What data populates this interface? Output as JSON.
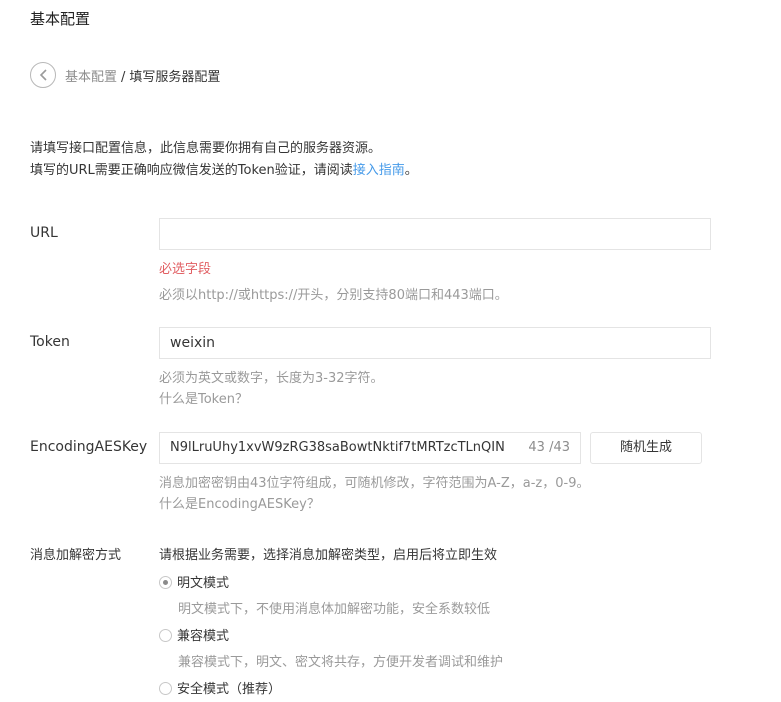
{
  "page_title": "基本配置",
  "breadcrumb": {
    "parent": "基本配置",
    "separator": "/",
    "current": "填写服务器配置"
  },
  "intro": {
    "line1": "请填写接口配置信息，此信息需要你拥有自己的服务器资源。",
    "line2_prefix": "填写的URL需要正确响应微信发送的Token验证，请阅读",
    "line2_link": "接入指南",
    "line2_suffix": "。"
  },
  "url": {
    "label": "URL",
    "value": "",
    "error": "必选字段",
    "hint": "必须以http://或https://开头，分别支持80端口和443端口。"
  },
  "token": {
    "label": "Token",
    "value": "weixin",
    "hint": "必须为英文或数字，长度为3-32字符。",
    "help_link": "什么是Token？"
  },
  "aes": {
    "label": "EncodingAESKey",
    "value": "N9lLruUhy1xvW9zRG38saBowtNktif7tMRTzcTLnQIN",
    "counter": "43 /43",
    "generate_button": "随机生成",
    "hint": "消息加密密钥由43位字符组成，可随机修改，字符范围为A-Z，a-z，0-9。",
    "help_link": "什么是EncodingAESKey？"
  },
  "encryption": {
    "label": "消息加解密方式",
    "description": "请根据业务需要，选择消息加解密类型，启用后将立即生效",
    "options": [
      {
        "label": "明文模式",
        "desc": "明文模式下，不使用消息体加解密功能，安全系数较低",
        "selected": true
      },
      {
        "label": "兼容模式",
        "desc": "兼容模式下，明文、密文将共存，方便开发者调试和维护",
        "selected": false
      },
      {
        "label": "安全模式（推荐）",
        "desc": "",
        "selected": false
      }
    ]
  },
  "colors": {
    "link": "#459ae9",
    "error": "#e15f63",
    "hint": "#9a9a9a",
    "border": "#e4e4e4"
  }
}
